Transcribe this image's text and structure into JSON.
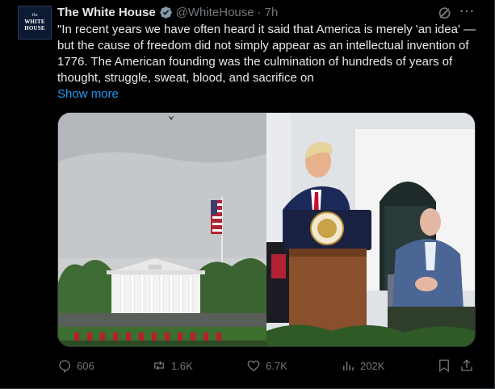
{
  "author": {
    "avatar_text_small": "The",
    "avatar_text_big_1": "WHITE",
    "avatar_text_big_2": "HOUSE",
    "name": "The White House",
    "handle": "@WhiteHouse",
    "separator": "·",
    "time": "7h",
    "verified_badge_color": "#829aab"
  },
  "tweet": {
    "text": "\"In recent years we have often heard it said that America is merely 'an idea' — but the cause of freedom did not simply appear as an intellectual invention of 1776. The American founding was the culmination of hundreds of years of thought, struggle, sweat, blood, and sacrifice on",
    "show_more": "Show more"
  },
  "media": {
    "left_description_icon": "white-house-flag-photo",
    "right_description_icon": "podium-speech-photo"
  },
  "actions": {
    "replies": "606",
    "reposts": "1.6K",
    "likes": "6.7K",
    "views": "202K"
  },
  "colors": {
    "background": "#000000",
    "text": "#e7e9ea",
    "muted": "#71767b",
    "link": "#1d9bf0",
    "border": "#2f3336"
  }
}
